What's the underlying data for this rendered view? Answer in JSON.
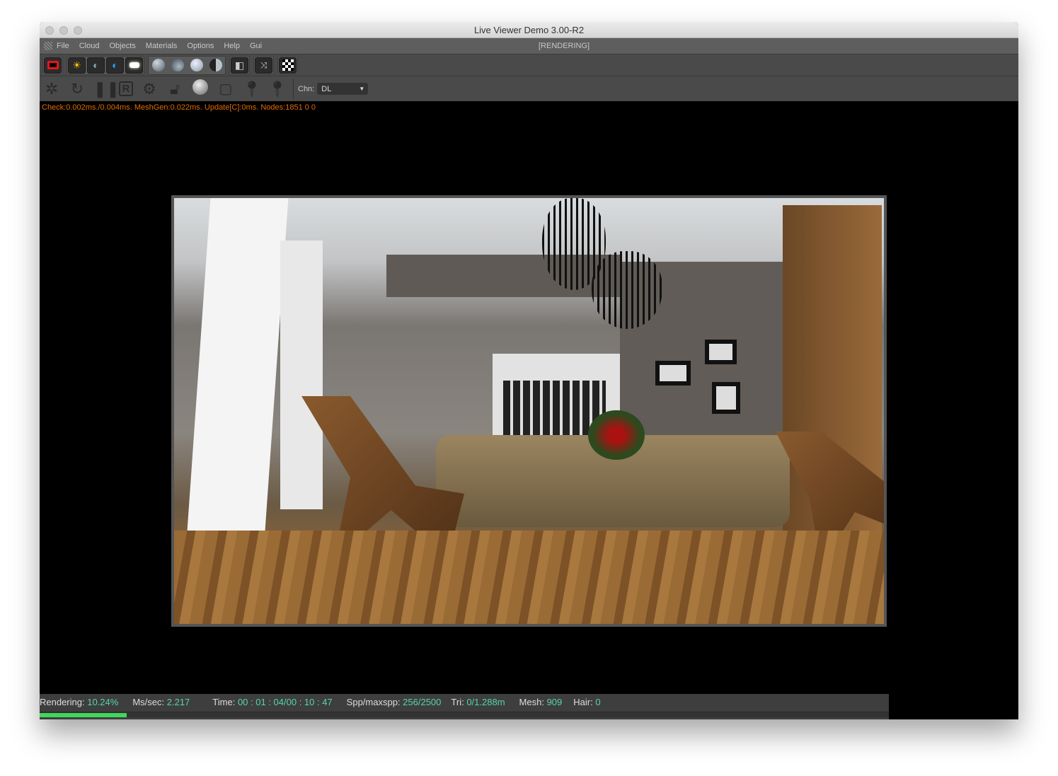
{
  "window": {
    "title": "Live Viewer Demo 3.00-R2"
  },
  "menu": {
    "items": [
      "File",
      "Cloud",
      "Objects",
      "Materials",
      "Options",
      "Help",
      "Gui"
    ],
    "status": "[RENDERING]"
  },
  "toolbar2": {
    "channel_label": "Chn:",
    "channel_value": "DL"
  },
  "perf_text": "Check:0.002ms./0.004ms. MeshGen:0.022ms. Update[C]:0ms. Nodes:1851  0 0",
  "status": {
    "rendering_label": "Rendering:",
    "rendering_value": "10.24%",
    "mssec_label": "Ms/sec:",
    "mssec_value": "2.217",
    "time_label": "Time:",
    "time_value": "00 : 01 : 04/00 : 10 : 47",
    "spp_label": "Spp/maxspp:",
    "spp_value": "256/2500",
    "tri_label": "Tri:",
    "tri_value": "0/1.288m",
    "mesh_label": "Mesh:",
    "mesh_value": "909",
    "hair_label": "Hair:",
    "hair_value": "0",
    "progress_percent": 10.24,
    "progress_color": "#3fd65a",
    "value_color": "#55d6a8"
  },
  "perf_color": "#e06a00"
}
